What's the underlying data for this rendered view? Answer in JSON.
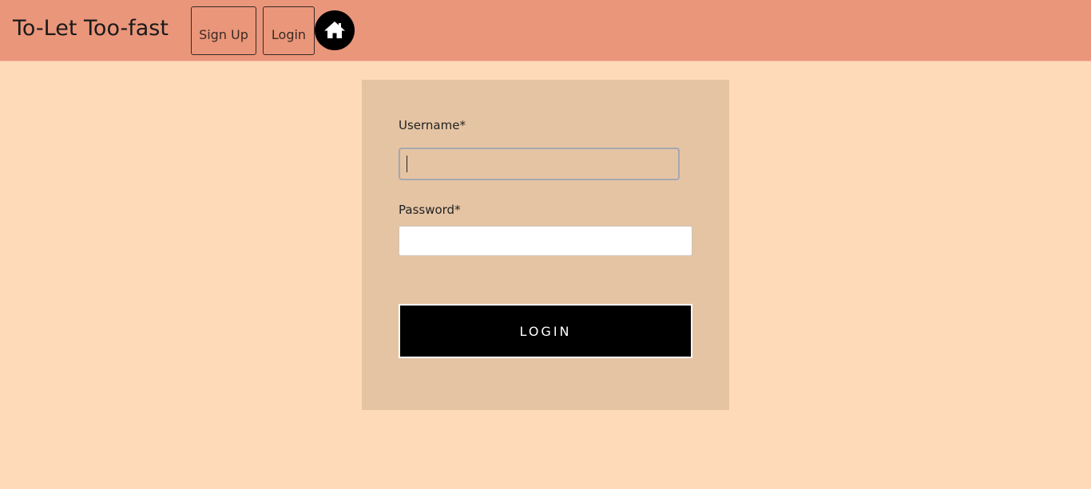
{
  "header": {
    "brand": "To-Let Too-fast",
    "signup_label": "Sign Up",
    "login_label": "Login",
    "home_icon": "home-icon"
  },
  "form": {
    "username_label": "Username*",
    "username_value": "",
    "password_label": "Password*",
    "password_value": "",
    "submit_label": "LOGIN"
  },
  "colors": {
    "header_bg": "#ea967a",
    "page_bg": "#ffdab9",
    "panel_bg": "#e5c4a4",
    "button_bg": "#000000"
  }
}
